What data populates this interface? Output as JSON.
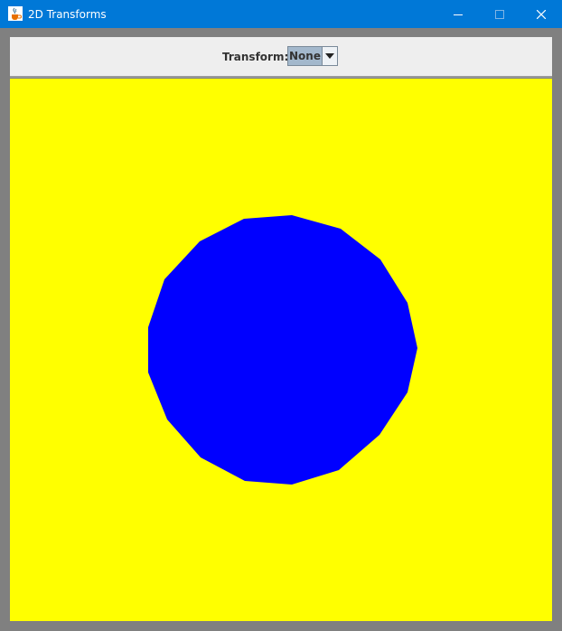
{
  "window": {
    "title": "2D Transforms",
    "icon": "java-cup-icon",
    "titlebar_color": "#0078d7"
  },
  "toolbar": {
    "transform_label": "Transform:",
    "transform_selected": "None"
  },
  "canvas": {
    "background_color": "#ffff00",
    "shape": "polygon",
    "shape_color": "#0000ff"
  }
}
